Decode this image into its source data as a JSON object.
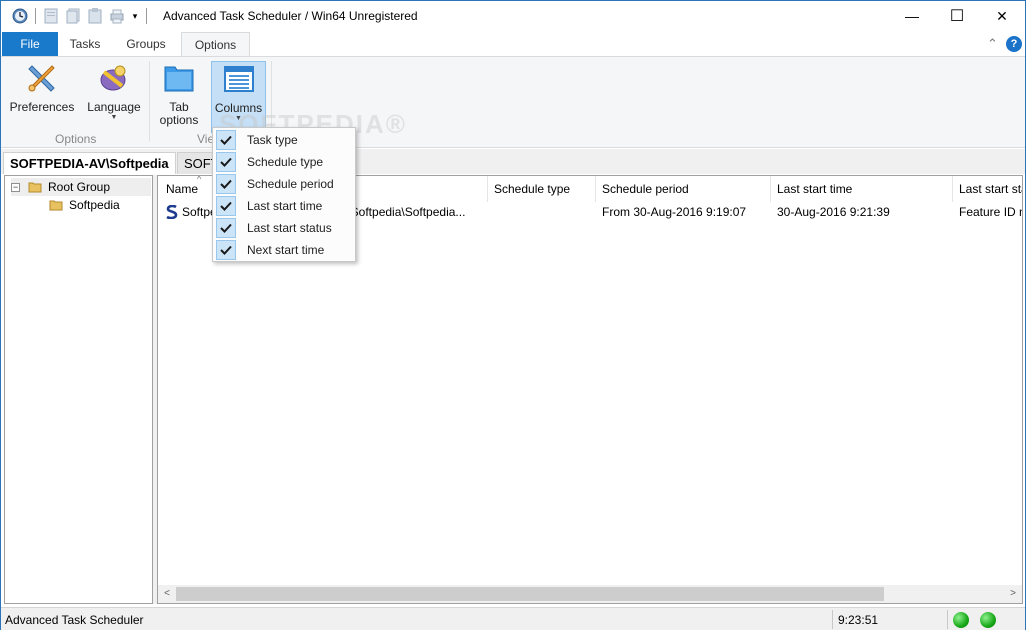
{
  "window": {
    "title": "Advanced Task Scheduler / Win64 Unregistered",
    "minimize_glyph": "—",
    "maximize_glyph": "☐",
    "close_glyph": "✕"
  },
  "ribbon_tabs": [
    "File",
    "Tasks",
    "Groups",
    "Options"
  ],
  "ribbon": {
    "buttons": {
      "preferences": "Preferences",
      "language": "Language",
      "tab_options_line1": "Tab",
      "tab_options_line2": "options",
      "columns": "Columns"
    },
    "groups": {
      "options": "Options",
      "view": "View"
    },
    "collapse_glyph": "⌃",
    "help_glyph": "?"
  },
  "doc_tabs": {
    "active": "SOFTPEDIA-AV\\Softpedia",
    "other": "SOFT"
  },
  "tree": {
    "root": "Root Group",
    "child": "Softpedia",
    "expander": "−"
  },
  "list": {
    "columns": [
      "Name",
      "",
      "Schedule type",
      "Schedule period",
      "Last start time",
      "Last start sta"
    ],
    "rows": [
      {
        "name": "Softpe",
        "path": ":\\Softpedia\\Softpedia...",
        "schedule_type": "",
        "schedule_period": "From 30-Aug-2016 9:19:07",
        "last_start_time": "30-Aug-2016 9:21:39",
        "last_start_status": "Feature ID n"
      }
    ],
    "scroll_left": "<",
    "scroll_right": ">"
  },
  "columns_menu": {
    "items": [
      {
        "label": "Task type",
        "checked": true
      },
      {
        "label": "Schedule type",
        "checked": true
      },
      {
        "label": "Schedule period",
        "checked": true
      },
      {
        "label": "Last start time",
        "checked": true
      },
      {
        "label": "Last start status",
        "checked": true
      },
      {
        "label": "Next start time",
        "checked": true
      }
    ]
  },
  "watermark": "SOFTPEDIA®",
  "statusbar": {
    "text": "Advanced Task Scheduler",
    "time": "9:23:51"
  },
  "colors": {
    "file_tab": "#1979ca",
    "status_led": "#18a818",
    "menu_check_bg": "#cce4f7"
  }
}
